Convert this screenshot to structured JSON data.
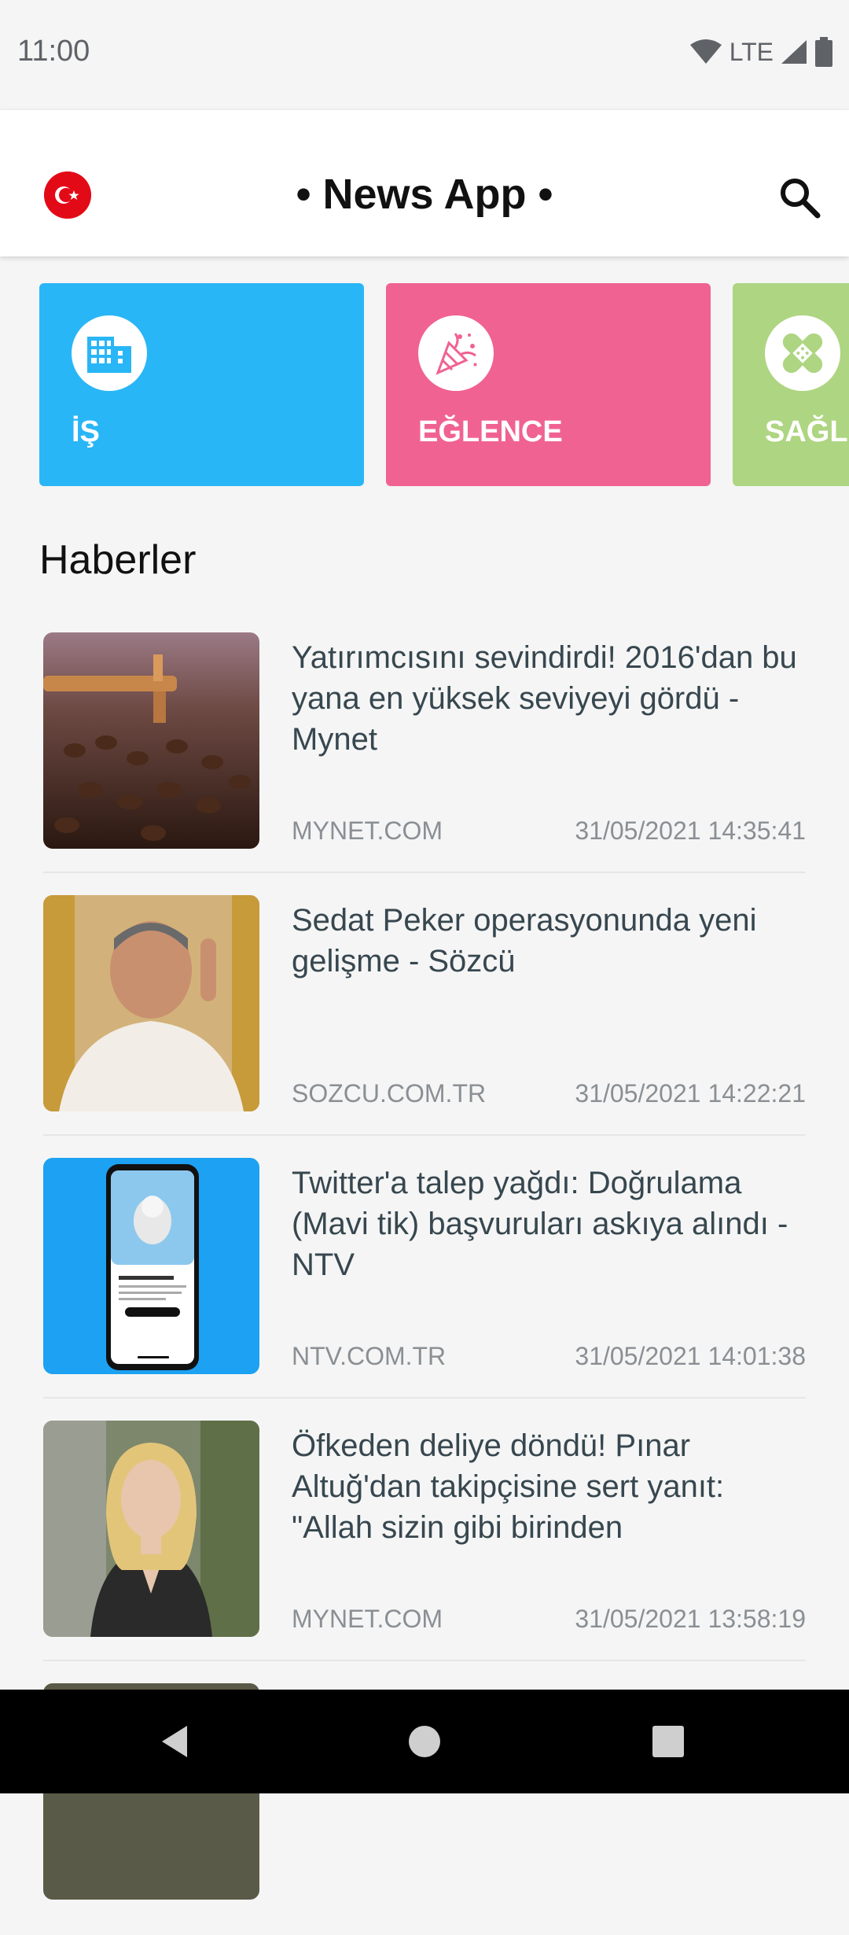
{
  "status_bar": {
    "time": "11:00",
    "network": "LTE",
    "icons": [
      "wifi-icon",
      "signal-icon",
      "battery-icon"
    ]
  },
  "app_bar": {
    "title": "• News App •",
    "flag_icon": "turkey-flag-icon",
    "search_icon": "search-icon"
  },
  "categories": [
    {
      "label": "İŞ",
      "icon": "building-icon",
      "color": "#29b6f6"
    },
    {
      "label": "EĞLENCE",
      "icon": "party-popper-icon",
      "color": "#f06292"
    },
    {
      "label": "SAĞLIK",
      "icon": "bandage-icon",
      "color": "#aed581"
    }
  ],
  "section": {
    "title": "Haberler"
  },
  "news": [
    {
      "title": "Yatırımcısını sevindirdi! 2016'dan bu yana en yüksek seviyeyi gördü - Mynet",
      "source": "MYNET.COM",
      "date": "31/05/2021 14:35:41"
    },
    {
      "title": "Sedat Peker operasyonunda yeni gelişme - Sözcü",
      "source": "SOZCU.COM.TR",
      "date": "31/05/2021 14:22:21"
    },
    {
      "title": "Twitter'a talep yağdı: Doğrulama (Mavi tik) başvuruları askıya alındı - NTV",
      "source": "NTV.COM.TR",
      "date": "31/05/2021 14:01:38"
    },
    {
      "title": "Öfkeden deliye döndü! Pınar Altuğ'dan takipçisine sert yanıt: \"Allah sizin gibi birinden",
      "source": "MYNET.COM",
      "date": "31/05/2021 13:58:19"
    }
  ],
  "thumb_colors": {
    "coffee": "#5a3a2a",
    "portrait_bg": "#c79a3a",
    "twitter_blue": "#1da1f2",
    "garden_bg": "#6b7a58"
  },
  "nav_bar": {
    "icons": [
      "back-icon",
      "home-icon",
      "recents-icon"
    ]
  }
}
